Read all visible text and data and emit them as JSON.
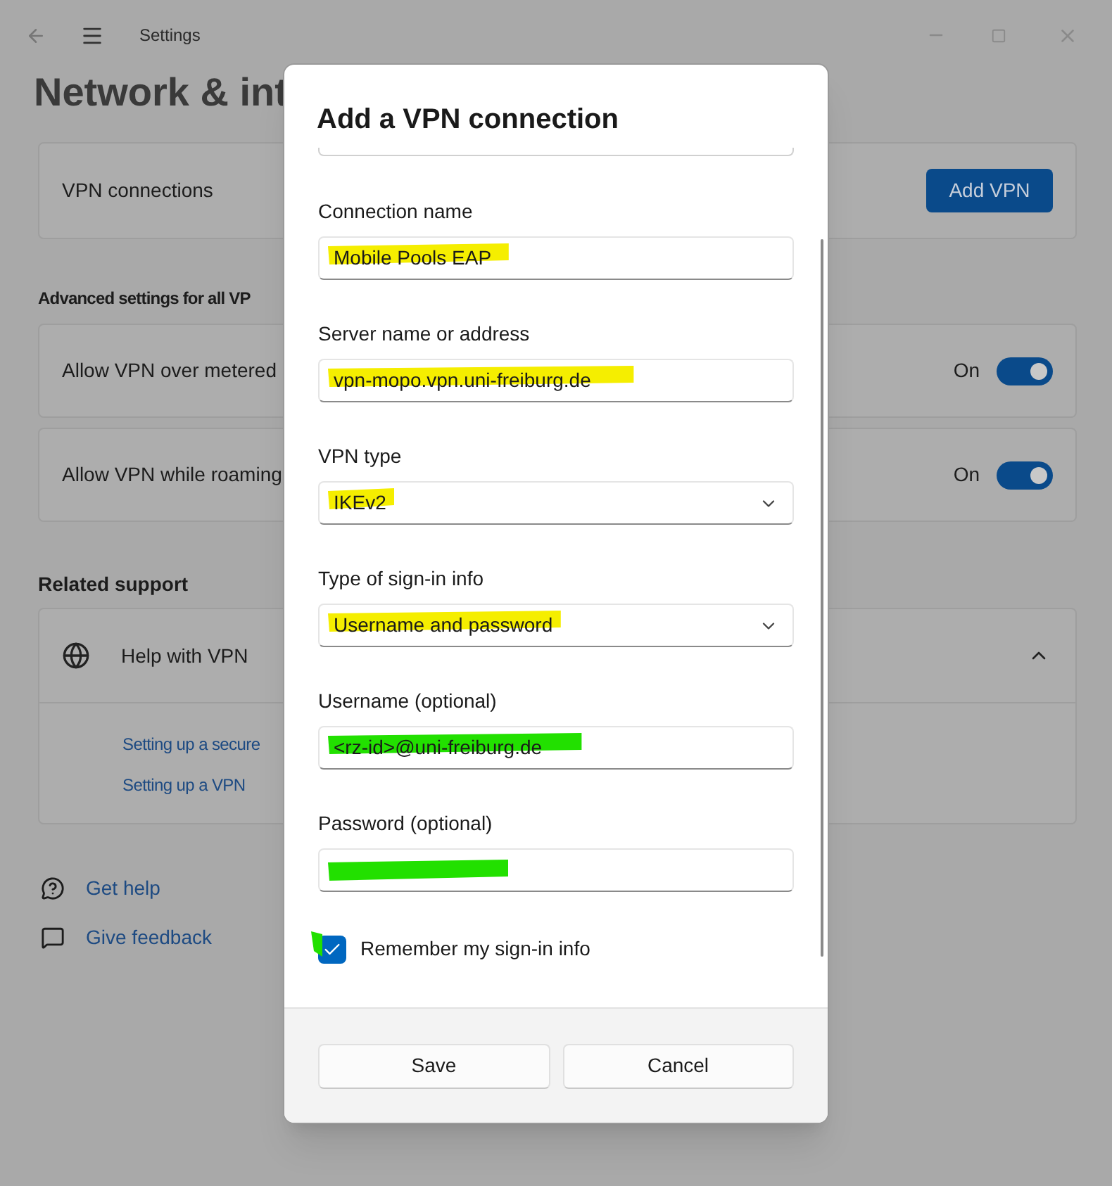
{
  "window": {
    "title": "Settings"
  },
  "page": {
    "title": "Network & int",
    "vpn_card": {
      "label": "VPN connections",
      "button": "Add VPN"
    },
    "advanced_heading": "Advanced settings for all VP",
    "toggles": [
      {
        "label": "Allow VPN over metered",
        "state": "On",
        "on": true
      },
      {
        "label": "Allow VPN while roaming",
        "state": "On",
        "on": true
      }
    ],
    "related_heading": "Related support",
    "help": {
      "title": "Help with VPN",
      "expanded": true,
      "links": [
        "Setting up a secure",
        "Setting up a VPN"
      ]
    },
    "footer_links": [
      {
        "kind": "help",
        "label": "Get help"
      },
      {
        "kind": "feedback",
        "label": "Give feedback"
      }
    ]
  },
  "dialog": {
    "title": "Add a VPN connection",
    "fields": [
      {
        "kind": "text",
        "label": "Connection name",
        "value": "Mobile Pools EAP",
        "color": "#f5ee00"
      },
      {
        "kind": "text",
        "label": "Server name or address",
        "value": "vpn-mopo.vpn.uni-freiburg.de",
        "color": "#f5ee00"
      },
      {
        "kind": "dropdown",
        "label": "VPN type",
        "value": "IKEv2",
        "color": "#f5ee00"
      },
      {
        "kind": "dropdown",
        "label": "Type of sign-in info",
        "value": "Username and password",
        "color": "#f5ee00"
      },
      {
        "kind": "text",
        "label": "Username (optional)",
        "value": "<rz-id>@uni-freiburg.de",
        "color": "#22e000"
      },
      {
        "kind": "password",
        "label": "Password (optional)",
        "color": "#22e000"
      }
    ],
    "remember": {
      "label": "Remember my sign-in info",
      "checked": true,
      "color": "#22e000"
    },
    "buttons": [
      "Save",
      "Cancel"
    ]
  }
}
